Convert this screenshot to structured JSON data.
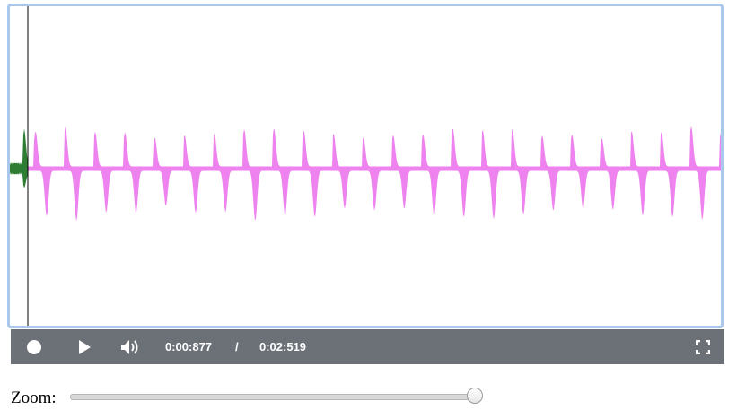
{
  "waveform": {
    "played_color": "#2e7d32",
    "unplayed_color": "#ee82ee",
    "cursor_color": "#000000",
    "progress_fraction": 0.026
  },
  "controls": {
    "record_icon": "record-icon",
    "play_icon": "play-icon",
    "volume_icon": "volume-icon",
    "fullscreen_icon": "fullscreen-icon",
    "current_time": "0:00:877",
    "separator": "/",
    "total_time": "0:02:519",
    "bar_color": "#6c7178"
  },
  "zoom": {
    "label": "Zoom:",
    "value_fraction": 1.0
  }
}
